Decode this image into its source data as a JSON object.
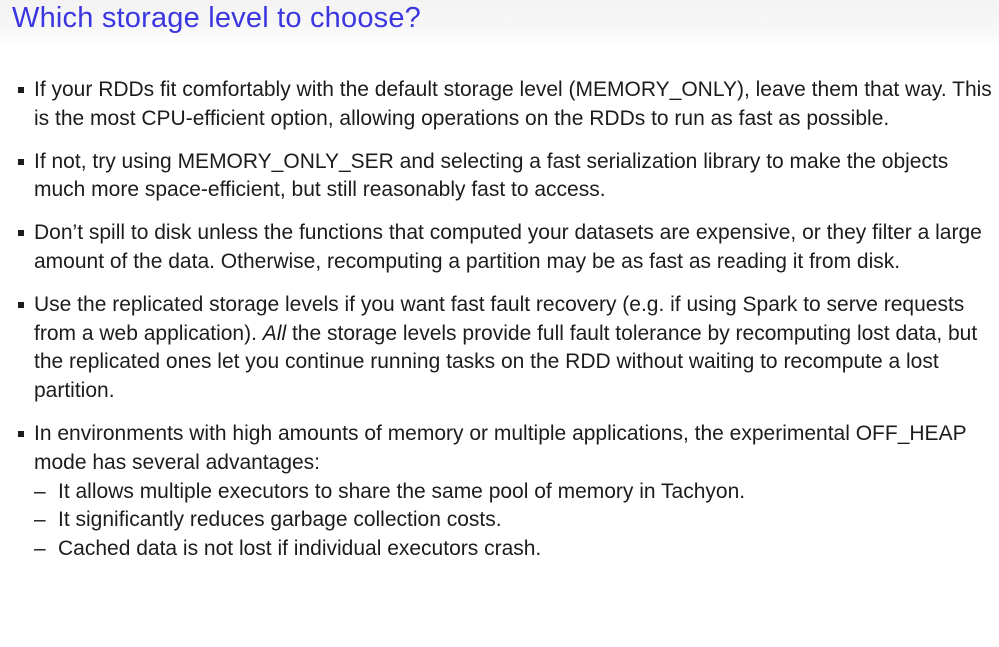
{
  "slide": {
    "title": "Which storage level to choose?",
    "bullets": [
      {
        "text": "If your RDDs fit comfortably with the default storage level (MEMORY_ONLY), leave them that way. This is the most CPU-efficient option, allowing operations on the RDDs to run as fast as possible."
      },
      {
        "text": "If not, try using MEMORY_ONLY_SER and selecting a fast serialization library to make the objects much more space-efficient, but still reasonably fast to access."
      },
      {
        "text": "Don’t spill to disk unless the functions that computed your datasets are expensive, or they filter a large amount of the data. Otherwise, recomputing a partition may be as fast as reading it from disk."
      },
      {
        "text_before": "Use the replicated storage levels if you want fast fault recovery (e.g. if using Spark to serve requests from a web application). ",
        "text_italic": "All",
        "text_after": " the storage levels provide full fault tolerance by recomputing lost data, but the replicated ones let you continue running tasks on the RDD without waiting to recompute a lost partition."
      },
      {
        "text": "In environments with high amounts of memory or multiple applications, the experimental OFF_HEAP mode has several advantages:",
        "sub_items": [
          "It allows multiple executors to share the same pool of memory in Tachyon.",
          "It significantly reduces garbage collection costs.",
          "Cached data is not lost if individual executors crash."
        ]
      }
    ],
    "dash": "–"
  }
}
